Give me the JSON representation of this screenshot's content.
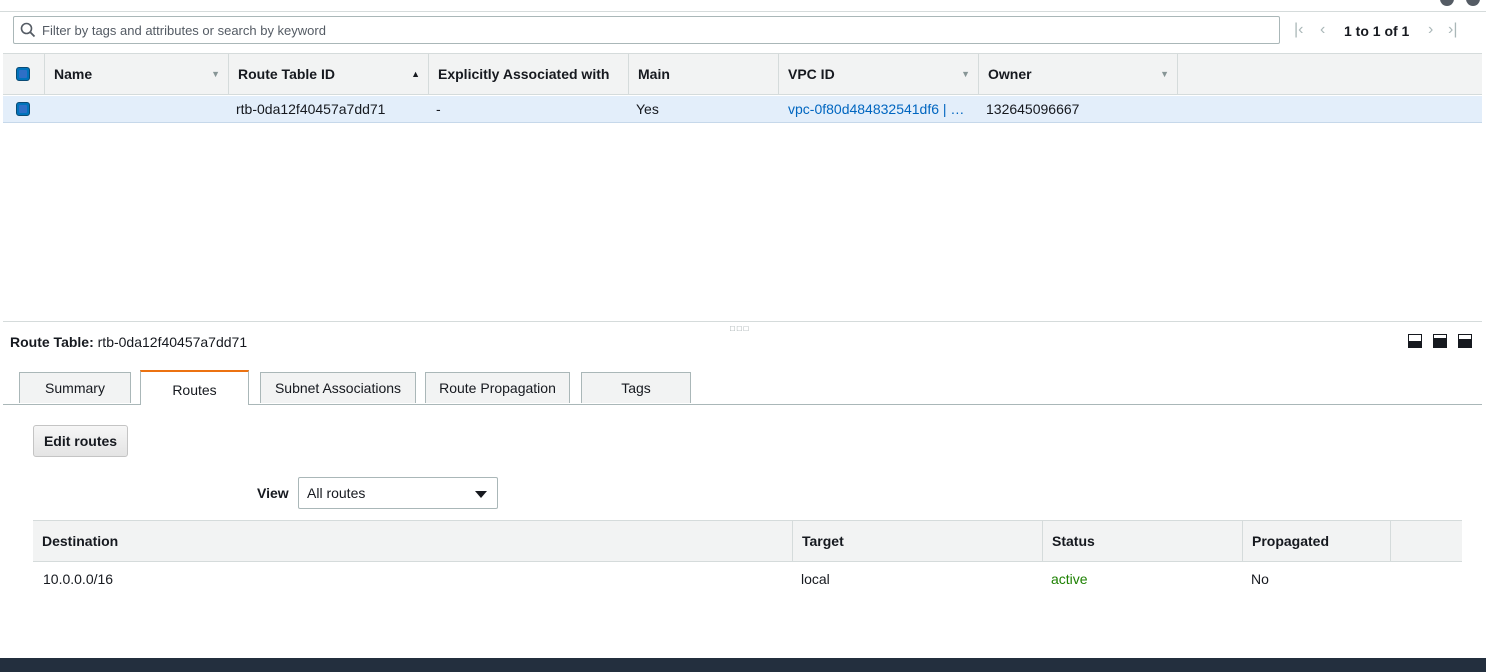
{
  "filter": {
    "placeholder": "Filter by tags and attributes or search by keyword"
  },
  "pager": {
    "text": "1 to 1 of 1"
  },
  "grid": {
    "columns": [
      "Name",
      "Route Table ID",
      "Explicitly Associated with",
      "Main",
      "VPC ID",
      "Owner"
    ],
    "rows": [
      {
        "name": "",
        "route_table_id": "rtb-0da12f40457a7dd71",
        "explicitly_associated": "-",
        "main": "Yes",
        "vpc_id": "vpc-0f80d484832541df6 | …",
        "owner": "132645096667"
      }
    ]
  },
  "details": {
    "title_label": "Route Table:",
    "title_value": "rtb-0da12f40457a7dd71",
    "tabs": [
      "Summary",
      "Routes",
      "Subnet Associations",
      "Route Propagation",
      "Tags"
    ],
    "active_tab": "Routes",
    "edit_routes_label": "Edit routes",
    "view_label": "View",
    "view_selected": "All routes",
    "routes": {
      "columns": [
        "Destination",
        "Target",
        "Status",
        "Propagated"
      ],
      "rows": [
        {
          "destination": "10.0.0.0/16",
          "target": "local",
          "status": "active",
          "propagated": "No"
        }
      ]
    }
  },
  "colors": {
    "accent": "#ec7211",
    "link": "#0066c0",
    "status_active": "#1d8102",
    "selected_row": "#e3eefa",
    "footer": "#232f3e"
  }
}
